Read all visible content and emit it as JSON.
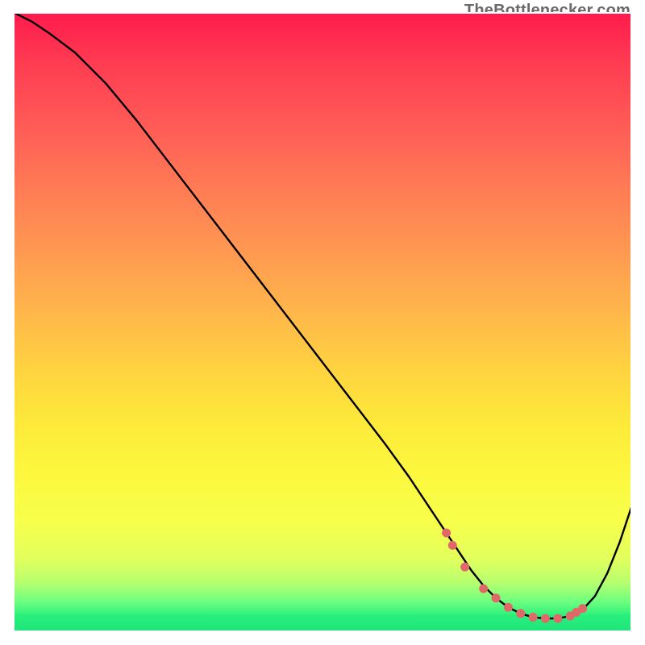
{
  "watermark": "TheBottlenecker.com",
  "chart_data": {
    "type": "line",
    "title": "",
    "xlabel": "",
    "ylabel": "",
    "xlim": [
      0,
      100
    ],
    "ylim": [
      0,
      100
    ],
    "series": [
      {
        "name": "curve",
        "x": [
          0,
          3,
          6,
          10,
          15,
          20,
          25,
          30,
          35,
          40,
          45,
          50,
          55,
          60,
          64,
          68,
          72,
          74,
          76,
          78,
          80,
          82,
          84,
          86,
          88,
          90,
          92,
          94,
          96,
          98,
          100
        ],
        "y": [
          100,
          98.5,
          96.5,
          93.5,
          88.5,
          82.5,
          76,
          69.5,
          63,
          56.5,
          50,
          43.5,
          37,
          30.5,
          25,
          19,
          13,
          10,
          7.5,
          5.5,
          4,
          3,
          2.4,
          2.2,
          2.2,
          2.6,
          3.6,
          5.8,
          9.5,
          14.5,
          20.5
        ]
      },
      {
        "name": "marker-dots",
        "x": [
          70,
          71,
          73,
          76,
          78,
          80,
          82,
          84,
          86,
          88,
          90,
          91,
          92
        ],
        "y": [
          16,
          14,
          10.5,
          7,
          5.5,
          4,
          3,
          2.4,
          2.2,
          2.2,
          2.6,
          3.2,
          3.8
        ]
      }
    ],
    "colors": {
      "curve": "#000000",
      "dots": "#e06868"
    }
  }
}
